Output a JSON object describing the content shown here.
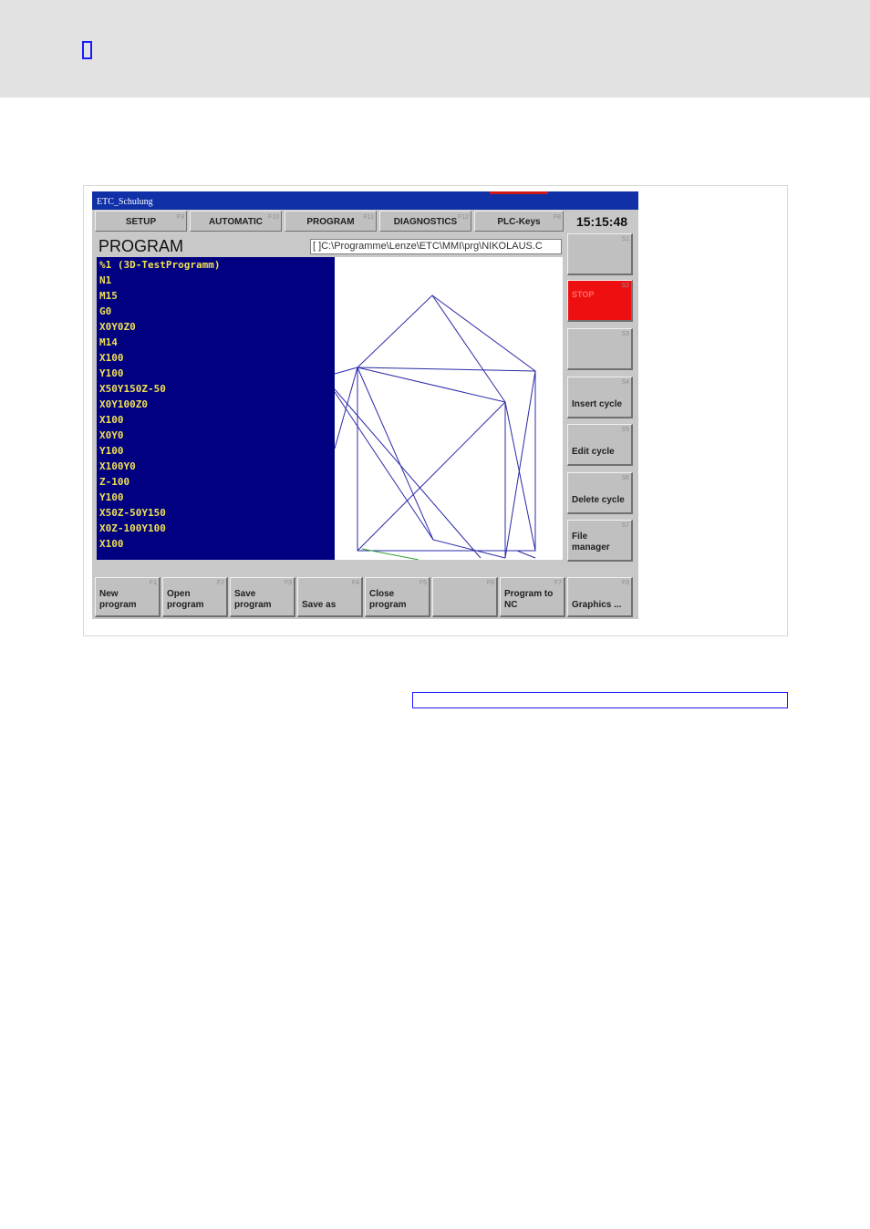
{
  "header": {
    "marker_icon": "empty-box-icon"
  },
  "screen": {
    "window_title": "ETC_Schulung",
    "top_tabs": [
      {
        "label": "SETUP",
        "fkey": "F9"
      },
      {
        "label": "AUTOMATIC",
        "fkey": "F10"
      },
      {
        "label": "PROGRAM",
        "fkey": "F11"
      },
      {
        "label": "DIAGNOSTICS",
        "fkey": "F12"
      },
      {
        "label": "PLC-Keys",
        "fkey": "F8"
      }
    ],
    "clock": "15:15:48",
    "program_title": "PROGRAM",
    "file_path": "[ ]C:\\Programme\\Lenze\\ETC\\MMI\\prg\\NIKOLAUS.C",
    "code_lines": [
      "%1 (3D-TestProgramm)",
      "N1",
      "M15",
      "G0",
      "X0Y0Z0",
      "M14",
      "X100",
      "Y100",
      "X50Y150Z-50",
      "X0Y100Z0",
      "X100",
      "X0Y0",
      "Y100",
      "X100Y0",
      "Z-100",
      "Y100",
      "X50Z-50Y150",
      "X0Z-100Y100",
      "X100"
    ],
    "side_buttons": [
      {
        "label": "",
        "fkey": "S1"
      },
      {
        "label": "STOP",
        "fkey": "S2"
      },
      {
        "label": "",
        "fkey": "S3"
      },
      {
        "label": "Insert cycle",
        "fkey": "S4"
      },
      {
        "label": "Edit cycle",
        "fkey": "S5"
      },
      {
        "label": "Delete cycle",
        "fkey": "S6"
      },
      {
        "label": "File\nmanager",
        "fkey": "S7"
      }
    ],
    "bottom_buttons": [
      {
        "label": "New\nprogram",
        "fkey": "F1"
      },
      {
        "label": "Open\nprogram",
        "fkey": "F2"
      },
      {
        "label": "Save\nprogram",
        "fkey": "F3"
      },
      {
        "label": "Save as",
        "fkey": "F4"
      },
      {
        "label": "Close\nprogram",
        "fkey": "F5"
      },
      {
        "label": "",
        "fkey": "F6"
      },
      {
        "label": "Program to\nNC",
        "fkey": "F7"
      },
      {
        "label": "Graphics ...",
        "fkey": "F8"
      }
    ],
    "colors": {
      "code_background": "#000080",
      "code_text": "#f0e050",
      "wireframe": "#2a2aa8",
      "stop_button": "#ee1010",
      "title_bar": "#1030a8"
    }
  }
}
